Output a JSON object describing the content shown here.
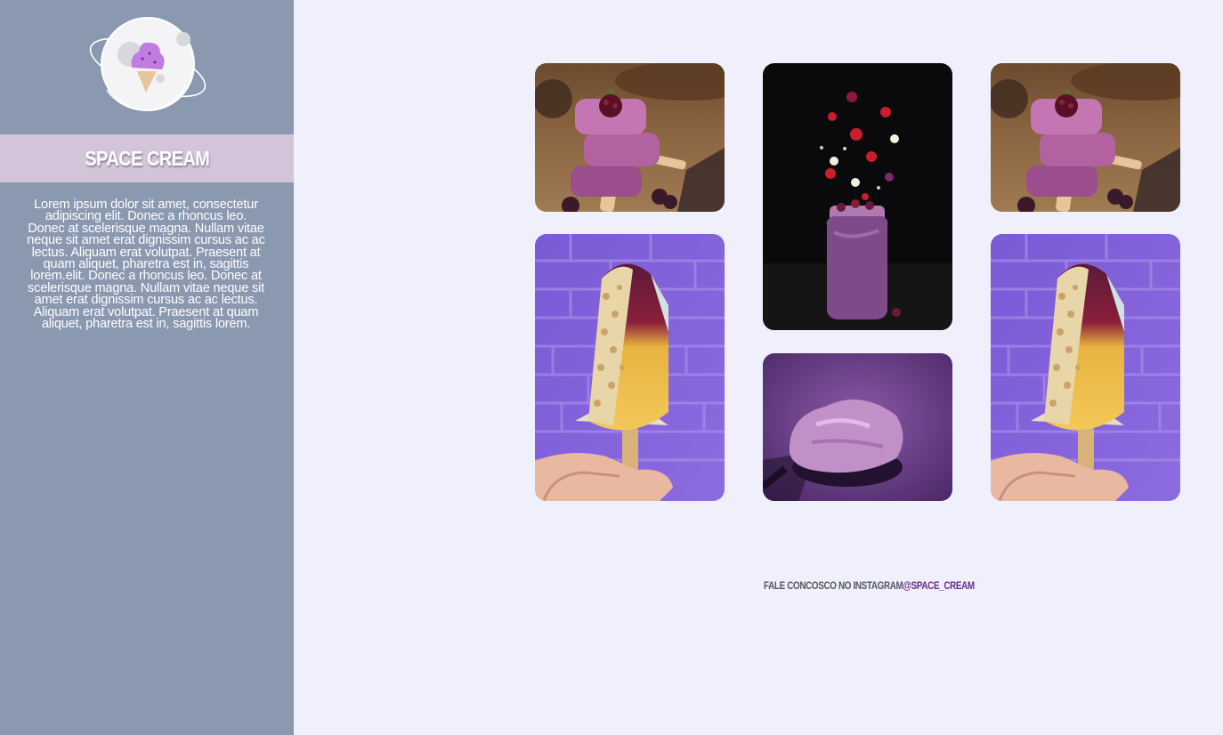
{
  "sidebar": {
    "logo_icon": "planet-ice-cream-icon",
    "brand_title": "SPACE CREAM",
    "about_text": "Lorem ipsum dolor sit amet, consectetur adipiscing elit. Donec a rhoncus leo. Donec at scelerisque magna. Nullam vitae neque sit amet erat dignissim cursus ac ac lectus. Aliquam erat volutpat. Praesent at quam aliquet, pharetra est in, sagittis lorem.elit. Donec a rhoncus leo. Donec at scelerisque magna. Nullam vitae neque sit amet erat dignissim cursus ac ac lectus. Aliquam erat volutpat. Praesent at quam aliquet, pharetra est in, sagittis lorem."
  },
  "gallery": {
    "photos": [
      {
        "subject": "stacked purple popsicles with raspberry"
      },
      {
        "subject": "smoothie jar with falling fruit"
      },
      {
        "subject": "stacked purple popsicles with raspberry"
      },
      {
        "subject": "popsicle with nuts against purple brick wall"
      },
      {
        "subject": "spoon of purple ice cream"
      },
      {
        "subject": "popsicle with nuts against purple brick wall"
      }
    ]
  },
  "footer": {
    "prefix": "FALE CONCOSCO NO INSTAGRAM",
    "handle": "@SPACE_CREAM"
  },
  "colors": {
    "sidebar_bg": "#8a98b0",
    "brand_band": "#d3c4d9",
    "page_bg": "#eff0fc",
    "handle_color": "#6b2a8a"
  }
}
